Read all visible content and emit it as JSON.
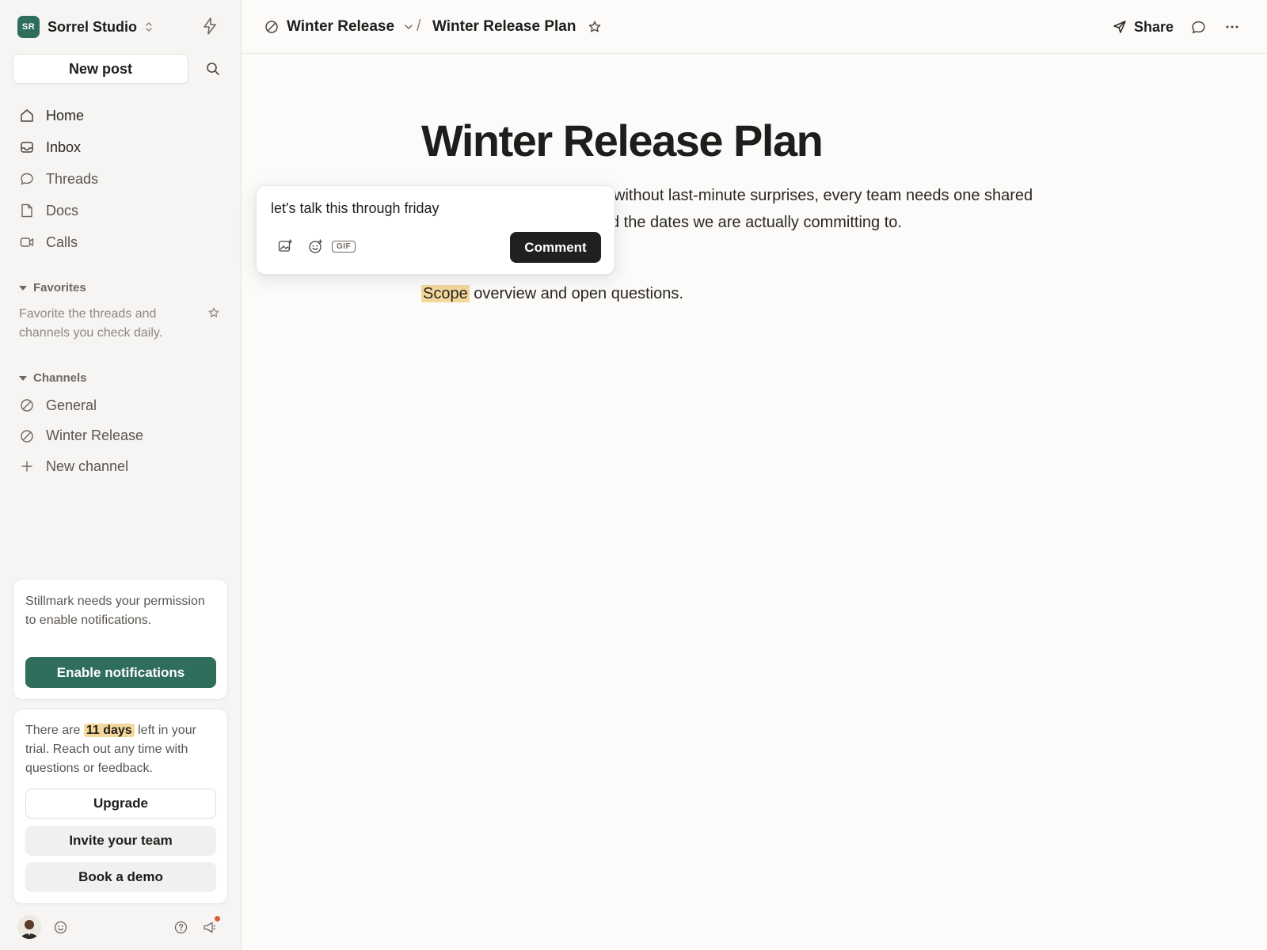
{
  "workspace": {
    "initials": "SR",
    "name": "Sorrel Studio"
  },
  "sidebar": {
    "new_post_label": "New post",
    "nav": [
      {
        "label": "Home",
        "icon": "home-icon"
      },
      {
        "label": "Inbox",
        "icon": "inbox-icon"
      },
      {
        "label": "Threads",
        "icon": "threads-icon"
      },
      {
        "label": "Docs",
        "icon": "docs-icon"
      },
      {
        "label": "Calls",
        "icon": "video-icon"
      }
    ],
    "favorites": {
      "heading": "Favorites",
      "empty_text": "Favorite the threads and channels you check daily."
    },
    "channels": {
      "heading": "Channels",
      "items": [
        {
          "label": "General",
          "icon": "channel-icon"
        },
        {
          "label": "Winter Release",
          "icon": "channel-icon"
        },
        {
          "label": "New channel",
          "icon": "plus-icon"
        }
      ]
    },
    "notifications_card": {
      "text": "Stillmark needs your permission to enable notifications.",
      "button_label": "Enable notifications"
    },
    "trial_card": {
      "text_before": "There are",
      "days_highlight": "11 days",
      "text_after": "left in your trial. Reach out any time with questions or feedback.",
      "upgrade_label": "Upgrade",
      "invite_label": "Invite your team",
      "demo_label": "Book a demo"
    }
  },
  "topbar": {
    "channel_crumb": "Winter Release",
    "doc_crumb": "Winter Release Plan",
    "separator": "/",
    "share_label": "Share"
  },
  "document": {
    "title": "Winter Release Plan",
    "paragraph_line1_visible": "without last-minute surprises, every team needs one shared",
    "paragraph_line2_visible": "d the dates we are actually committing to.",
    "scope_word": "Scope",
    "second_line_rest": " overview and open questions."
  },
  "comment_popover": {
    "input_value": "let's talk this through friday",
    "gif_label": "GIF",
    "comment_button_label": "Comment"
  },
  "colors": {
    "accent_green": "#2f6e5c",
    "highlight": "#f4d89b",
    "dark_button": "#22201e",
    "notification_dot": "#e05a3a"
  }
}
